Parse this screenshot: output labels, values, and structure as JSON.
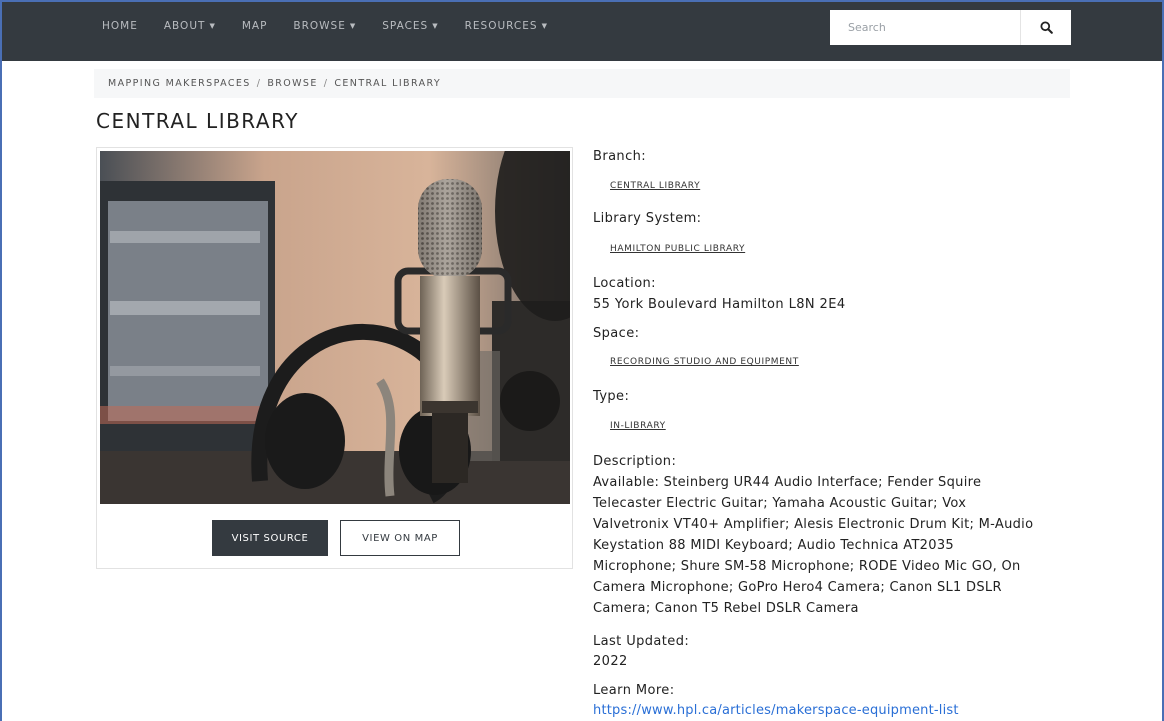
{
  "nav": {
    "items": [
      {
        "label": "HOME",
        "has_caret": false
      },
      {
        "label": "ABOUT",
        "has_caret": true
      },
      {
        "label": "MAP",
        "has_caret": false
      },
      {
        "label": "BROWSE",
        "has_caret": true
      },
      {
        "label": "SPACES",
        "has_caret": true
      },
      {
        "label": "RESOURCES",
        "has_caret": true
      }
    ],
    "search_placeholder": "Search",
    "search_icon": "search-icon"
  },
  "breadcrumb": {
    "items": [
      "MAPPING MAKERSPACES",
      "BROWSE",
      "CENTRAL LIBRARY"
    ],
    "separator": "/"
  },
  "page": {
    "title": "CENTRAL LIBRARY"
  },
  "card": {
    "image_subject": "microphone and headphones in recording studio",
    "visit_source_label": "VISIT SOURCE",
    "view_on_map_label": "VIEW ON MAP"
  },
  "details": {
    "branch_label": "Branch:",
    "branch_value": "CENTRAL LIBRARY",
    "system_label": "Library System:",
    "system_value": "HAMILTON PUBLIC LIBRARY",
    "location_label": "Location:",
    "location_value": "55 York Boulevard Hamilton L8N 2E4",
    "space_label": "Space:",
    "space_value": "RECORDING STUDIO AND EQUIPMENT",
    "type_label": "Type:",
    "type_value": "IN-LIBRARY",
    "description_label": "Description:",
    "description_lines": [
      "Available: Steinberg UR44 Audio Interface; Fender Squire",
      "Telecaster Electric Guitar; Yamaha Acoustic Guitar; Vox",
      "Valvetronix VT40+ Amplifier; Alesis Electronic Drum Kit; M-Audio",
      "Keystation 88 MIDI Keyboard; Audio Technica AT2035",
      "Microphone; Shure SM-58 Microphone; RODE Video Mic GO, On",
      "Camera Microphone; GoPro Hero4 Camera; Canon SL1 DSLR",
      "Camera; Canon T5 Rebel DSLR Camera"
    ],
    "updated_label": "Last Updated:",
    "updated_value": "2022",
    "learn_label": "Learn More:",
    "learn_url": "https://www.hpl.ca/articles/makerspace-equipment-list"
  },
  "colors": {
    "nav_bg": "#343a40",
    "nav_text": "#b9bcc0",
    "breadcrumb_bg": "#f6f7f8",
    "button_dark": "#343a40",
    "link_blue": "#2a6fd6",
    "frame_border": "#4a6fb5"
  }
}
